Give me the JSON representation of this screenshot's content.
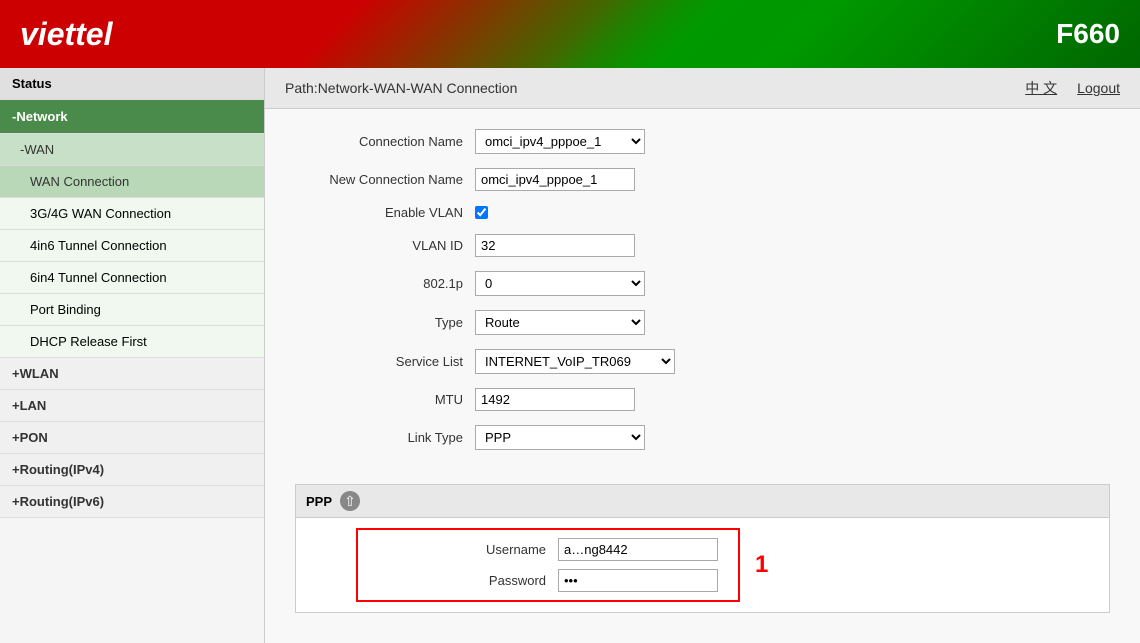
{
  "header": {
    "logo": "viettel",
    "model": "F660"
  },
  "path": {
    "text": "Path:Network-WAN-WAN Connection",
    "lang_link": "中 文",
    "logout_link": "Logout"
  },
  "sidebar": {
    "items": [
      {
        "label": "Status",
        "type": "top",
        "active": false
      },
      {
        "label": "-Network",
        "type": "section",
        "active": true
      },
      {
        "label": "-WAN",
        "type": "sub",
        "active": true
      },
      {
        "label": "WAN Connection",
        "type": "subsub",
        "selected": true
      },
      {
        "label": "3G/4G WAN Connection",
        "type": "subsub",
        "selected": false
      },
      {
        "label": "4in6 Tunnel Connection",
        "type": "subsub",
        "selected": false
      },
      {
        "label": "6in4 Tunnel Connection",
        "type": "subsub",
        "selected": false
      },
      {
        "label": "Port Binding",
        "type": "subsub",
        "selected": false
      },
      {
        "label": "DHCP Release First",
        "type": "subsub",
        "selected": false
      },
      {
        "label": "+WLAN",
        "type": "plus",
        "active": false
      },
      {
        "label": "+LAN",
        "type": "plus",
        "active": false
      },
      {
        "label": "+PON",
        "type": "plus",
        "active": false
      },
      {
        "label": "+Routing(IPv4)",
        "type": "plus",
        "active": false
      },
      {
        "label": "+Routing(IPv6)",
        "type": "plus",
        "active": false
      }
    ]
  },
  "form": {
    "connection_name_label": "Connection Name",
    "connection_name_value": "omci_ipv4_pppoe_1",
    "new_connection_name_label": "New Connection Name",
    "new_connection_name_value": "omci_ipv4_pppoe_1",
    "enable_vlan_label": "Enable VLAN",
    "vlan_id_label": "VLAN ID",
    "vlan_id_value": "32",
    "dot1p_label": "802.1p",
    "dot1p_value": "0",
    "type_label": "Type",
    "type_value": "Route",
    "service_list_label": "Service List",
    "service_list_value": "INTERNET_VoIP_TR069",
    "mtu_label": "MTU",
    "mtu_value": "1492",
    "link_type_label": "Link Type",
    "link_type_value": "PPP",
    "ppp_label": "PPP",
    "username_label": "Username",
    "username_value": "a…ng8442",
    "password_label": "Password",
    "password_value": "••••••",
    "annotation": "1"
  }
}
